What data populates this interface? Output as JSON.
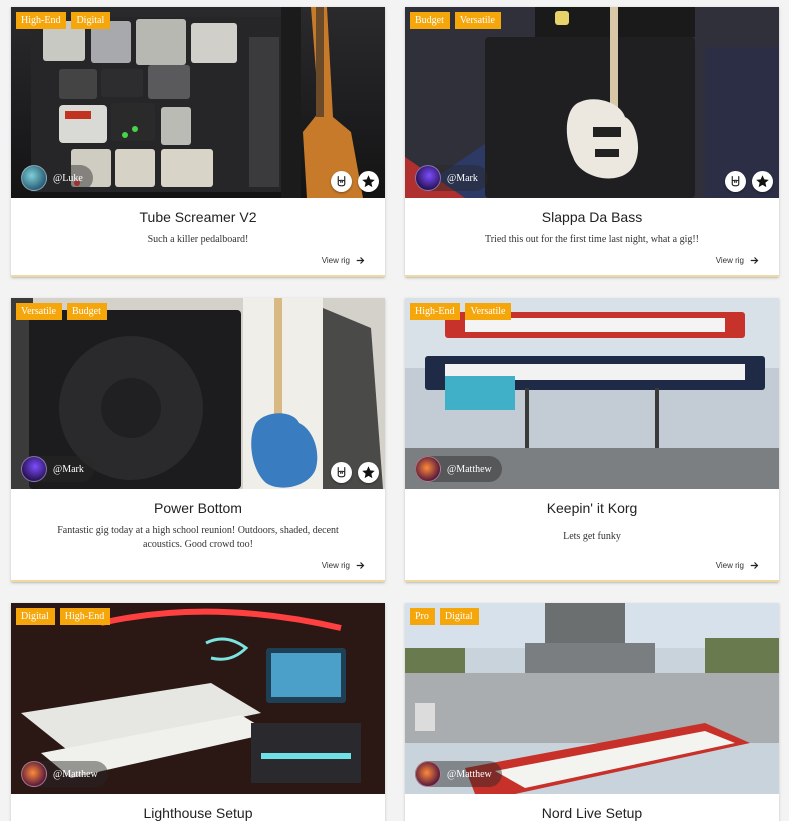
{
  "cards": [
    {
      "tags": [
        "High-End",
        "Digital"
      ],
      "user": "@Luke",
      "title": "Tube Screamer V2",
      "description": "Such a killer pedalboard!",
      "view_label": "View rig",
      "show_actions": true
    },
    {
      "tags": [
        "Budget",
        "Versatile"
      ],
      "user": "@Mark",
      "title": "Slappa Da Bass",
      "description": "Tried this out for the first time last night, what a gig!!",
      "view_label": "View rig",
      "show_actions": true
    },
    {
      "tags": [
        "Versatile",
        "Budget"
      ],
      "user": "@Mark",
      "title": "Power Bottom",
      "description": "Fantastic gig today at a high school reunion! Outdoors, shaded, decent acoustics. Good crowd too!",
      "view_label": "View rig",
      "show_actions": true
    },
    {
      "tags": [
        "High-End",
        "Versatile"
      ],
      "user": "@Matthew",
      "title": "Keepin' it Korg",
      "description": "Lets get funky",
      "view_label": "View rig",
      "show_actions": false
    },
    {
      "tags": [
        "Digital",
        "High-End"
      ],
      "user": "@Matthew",
      "title": "Lighthouse Setup",
      "show_actions": false
    },
    {
      "tags": [
        "Pro",
        "Digital"
      ],
      "user": "@Matthew",
      "title": "Nord Live Setup",
      "show_actions": false
    }
  ],
  "icons": {
    "rock_on": "rock-hand-icon",
    "favorite": "star-icon",
    "arrow": "arrow-right-icon"
  },
  "colors": {
    "tag_bg": "#f5a60b",
    "card_bg": "#ffffff",
    "page_bg": "#f3f3f3"
  }
}
